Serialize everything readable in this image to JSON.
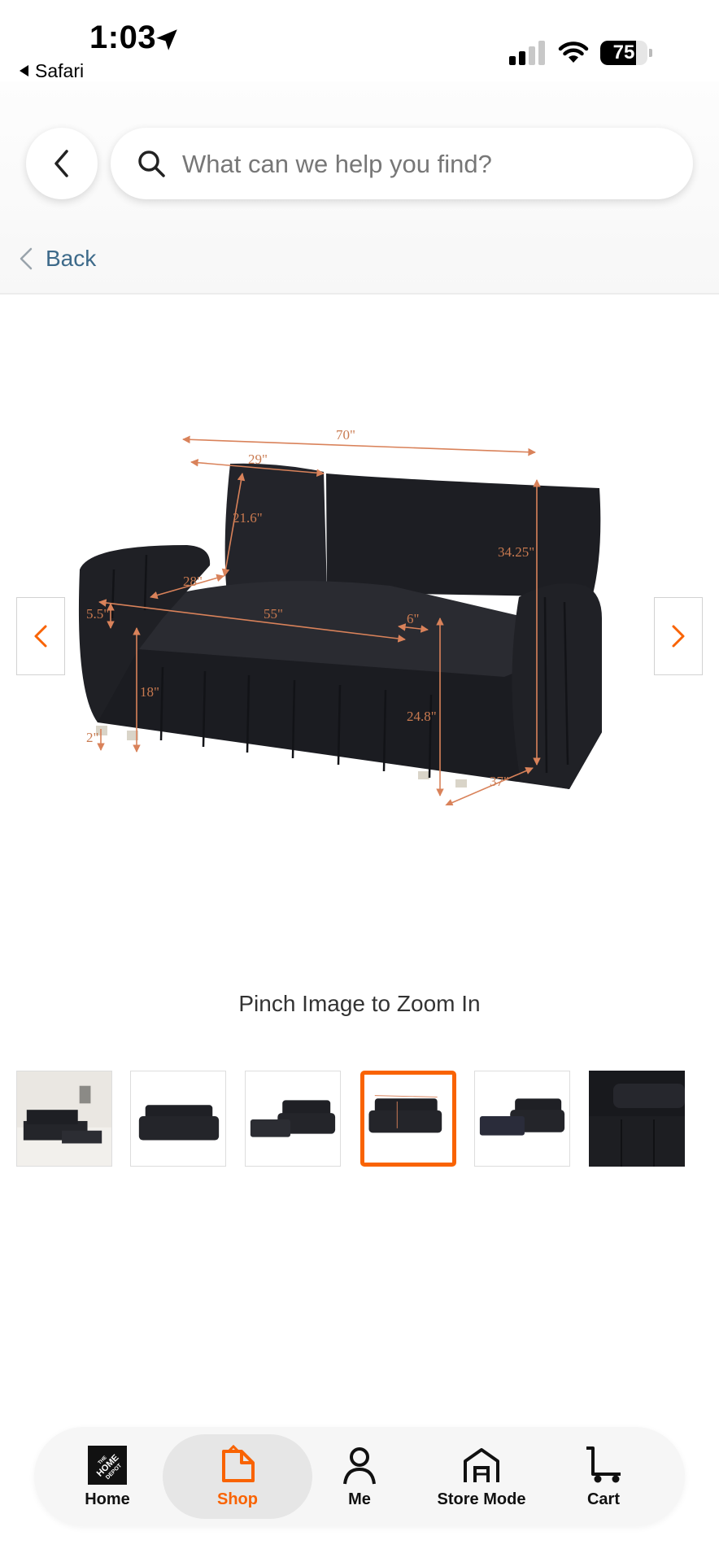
{
  "status_bar": {
    "time": "1:03",
    "back_app": "Safari",
    "battery": "75",
    "battery_level": 0.75
  },
  "header": {
    "search_placeholder": "What can we help you find?",
    "back_label": "Back"
  },
  "product_image": {
    "dimensions": {
      "width": "70\"",
      "cushion_width": "29\"",
      "back_height": "21.6\"",
      "seat_depth": "28\"",
      "seat_width": "55\"",
      "cushion_thickness": "5.5\"",
      "arm_width": "6\"",
      "overall_height": "34.25\"",
      "seat_height": "18\"",
      "leg_height": "2\"",
      "arm_height": "24.8\"",
      "depth": "37\""
    },
    "zoom_hint": "Pinch Image to Zoom In"
  },
  "thumbnails": {
    "count": 6,
    "selected_index": 3
  },
  "bottom_nav": {
    "items": [
      {
        "label": "Home",
        "icon": "home-depot-logo-icon"
      },
      {
        "label": "Shop",
        "icon": "shop-tag-icon"
      },
      {
        "label": "Me",
        "icon": "person-icon"
      },
      {
        "label": "Store Mode",
        "icon": "store-icon"
      },
      {
        "label": "Cart",
        "icon": "cart-icon"
      }
    ],
    "active": "Shop"
  },
  "colors": {
    "accent": "#f96302",
    "link": "#3d6a8a",
    "sofa": "#1c1d22"
  }
}
